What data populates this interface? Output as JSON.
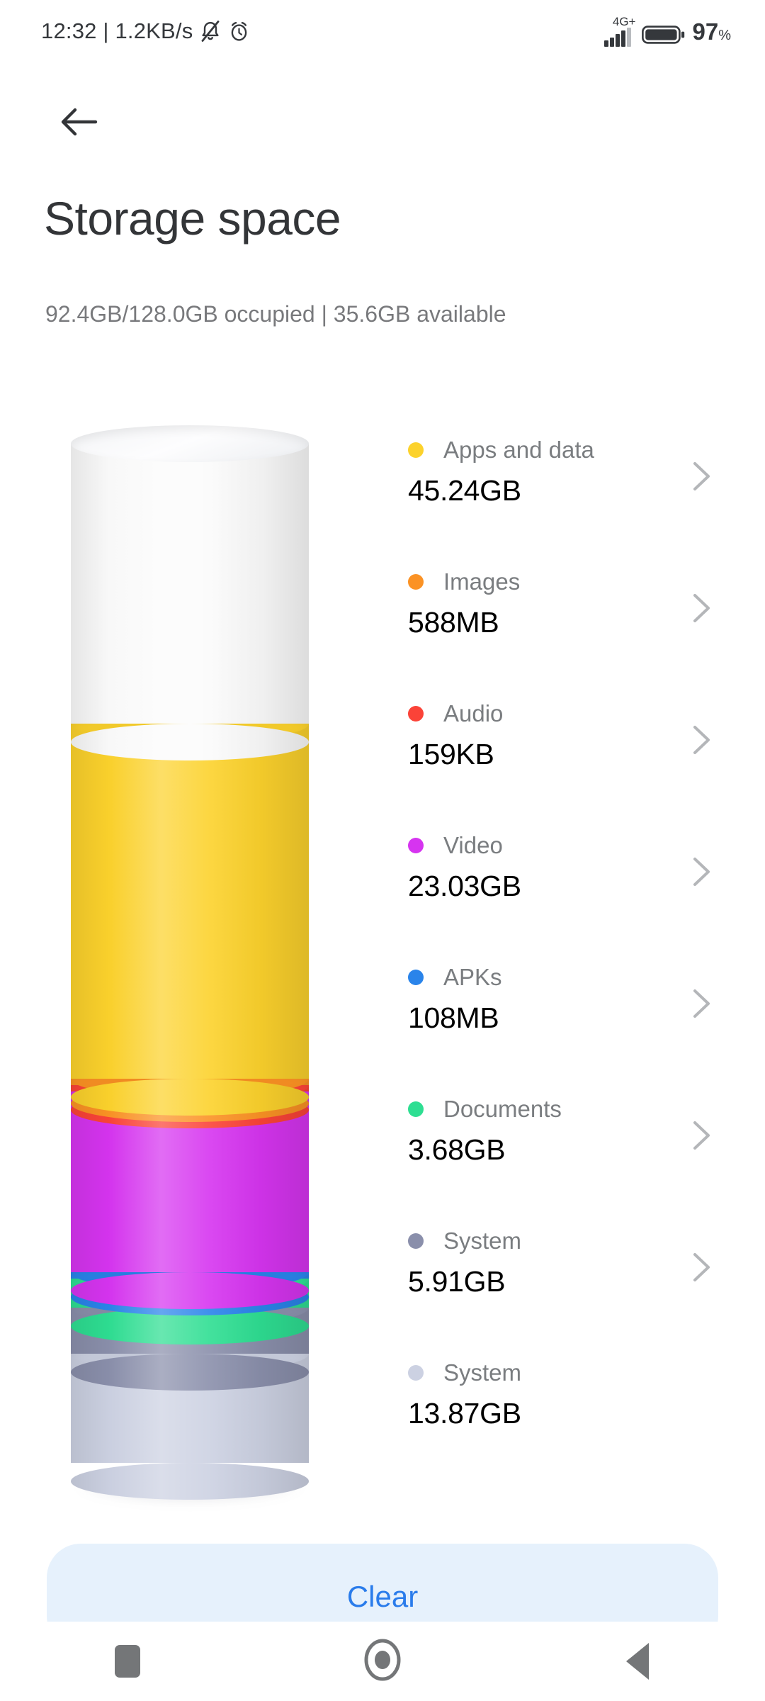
{
  "statusbar": {
    "clock_text": "12:32 | 1.2KB/s",
    "mute_icon": "bell-muted-icon",
    "alarm_icon": "alarm-clock-icon",
    "network_label": "4G+",
    "signal_icon": "signal-bars-icon",
    "signal_bars_filled": 4,
    "signal_bars_total": 5,
    "battery_icon": "battery-icon",
    "battery_level": "97",
    "battery_unit": "%"
  },
  "header": {
    "back_icon": "arrow-left-icon",
    "title": "Storage space",
    "subtitle": "92.4GB/128.0GB occupied | 35.6GB available"
  },
  "chart_data": {
    "type": "bar",
    "title": "Storage space",
    "subtitle": "92.4GB/128.0GB occupied | 35.6GB available",
    "render": "stacked-3d-cylinder",
    "unit": "GB",
    "total_capacity_gb": 128.0,
    "occupied_gb": 92.4,
    "available_gb": 35.6,
    "categories": [
      "Free",
      "Apps and data",
      "Images",
      "Audio",
      "Video",
      "APKs",
      "Documents",
      "System",
      "System"
    ],
    "values": [
      35.6,
      45.24,
      0.588,
      0.000159,
      23.03,
      0.108,
      3.68,
      5.91,
      13.87
    ],
    "colors": [
      "#fbfbfb",
      "#fcd22c",
      "#fb9224",
      "#fb4338",
      "#d634f0",
      "#2a84ea",
      "#2ede92",
      "#8a8fab",
      "#ccd1e2"
    ],
    "segments": [
      {
        "name": "Free",
        "label": "",
        "value_gb": 35.6,
        "display": "35.6GB available",
        "color": "#fbfbfb",
        "legend": false
      },
      {
        "name": "Apps and data",
        "label": "Apps and data",
        "value_gb": 45.24,
        "display": "45.24GB",
        "color": "#fcd22c",
        "legend": true
      },
      {
        "name": "Images",
        "label": "Images",
        "value_gb": 0.588,
        "display": "588MB",
        "color": "#fb9224",
        "legend": true
      },
      {
        "name": "Audio",
        "label": "Audio",
        "value_gb": 0.000159,
        "display": "159KB",
        "color": "#fb4338",
        "legend": true
      },
      {
        "name": "Video",
        "label": "Video",
        "value_gb": 23.03,
        "display": "23.03GB",
        "color": "#d634f0",
        "legend": true
      },
      {
        "name": "APKs",
        "label": "APKs",
        "value_gb": 0.108,
        "display": "108MB",
        "color": "#2a84ea",
        "legend": true
      },
      {
        "name": "Documents",
        "label": "Documents",
        "value_gb": 3.68,
        "display": "3.68GB",
        "color": "#2ede92",
        "legend": true
      },
      {
        "name": "System",
        "label": "System",
        "value_gb": 5.91,
        "display": "5.91GB",
        "color": "#8a8fab",
        "legend": true
      },
      {
        "name": "System",
        "label": "System",
        "value_gb": 13.87,
        "display": "13.87GB",
        "color": "#ccd1e2",
        "legend": true
      }
    ],
    "xlabel": "",
    "ylabel": "",
    "legend_position": "right",
    "grid": false
  },
  "legend": {
    "chevron_icon": "chevron-right-icon",
    "items": [
      {
        "label": "Apps and data",
        "value": "45.24GB",
        "color": "#fcd22c",
        "chevron": true
      },
      {
        "label": "Images",
        "value": "588MB",
        "color": "#fb9224",
        "chevron": true
      },
      {
        "label": "Audio",
        "value": "159KB",
        "color": "#fb4338",
        "chevron": true
      },
      {
        "label": "Video",
        "value": "23.03GB",
        "color": "#d634f0",
        "chevron": true
      },
      {
        "label": "APKs",
        "value": "108MB",
        "color": "#2a84ea",
        "chevron": true
      },
      {
        "label": "Documents",
        "value": "3.68GB",
        "color": "#2ede92",
        "chevron": true
      },
      {
        "label": "System",
        "value": "5.91GB",
        "color": "#8a8fab",
        "chevron": true
      },
      {
        "label": "System",
        "value": "13.87GB",
        "color": "#ccd1e2",
        "chevron": false
      }
    ]
  },
  "footer": {
    "clear_label": "Clear"
  },
  "navbar": {
    "recents_icon": "square-recents-icon",
    "home_icon": "circle-home-icon",
    "back_icon": "triangle-back-icon"
  },
  "colors": {
    "accent": "#2a7ceb",
    "clear_button_bg": "#e6f1fc",
    "title": "#333538",
    "subtitle": "#78797c",
    "value_text": "#000000",
    "label_text": "#7a7d80"
  }
}
